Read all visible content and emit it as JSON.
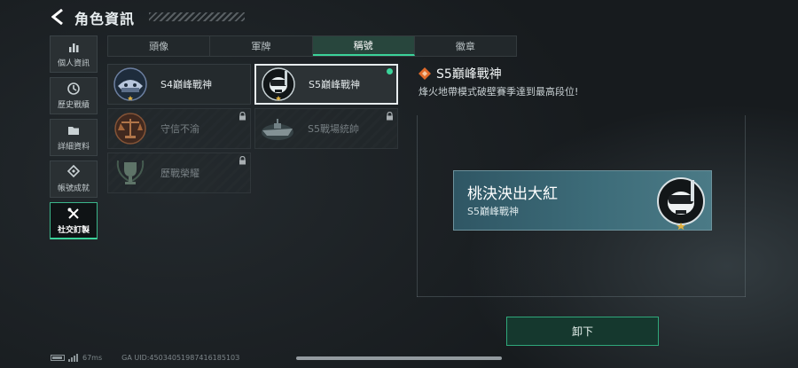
{
  "header": {
    "title": "角色資訊"
  },
  "sidebar": {
    "items": [
      {
        "label": "個人資訊",
        "icon": "bar-chart-icon",
        "active": false
      },
      {
        "label": "歷史戰績",
        "icon": "history-icon",
        "active": false
      },
      {
        "label": "詳細資料",
        "icon": "folder-icon",
        "active": false
      },
      {
        "label": "帳號成就",
        "icon": "achievement-icon",
        "active": false
      },
      {
        "label": "社交訂製",
        "icon": "tools-icon",
        "active": true
      }
    ]
  },
  "tabs": [
    {
      "label": "頭像",
      "active": false
    },
    {
      "label": "軍牌",
      "active": false
    },
    {
      "label": "稱號",
      "active": true
    },
    {
      "label": "徽章",
      "active": false
    }
  ],
  "titles": [
    {
      "name": "S4巔峰戰神",
      "emblem": "armored-skull-emblem",
      "locked": false,
      "selected": false,
      "equipped": false
    },
    {
      "name": "S5巔峰戰神",
      "emblem": "diver-skull-emblem",
      "locked": false,
      "selected": true,
      "equipped": true
    },
    {
      "name": "守信不渝",
      "emblem": "scales-emblem",
      "locked": true,
      "selected": false,
      "equipped": false
    },
    {
      "name": "S5戰場統帥",
      "emblem": "warship-emblem",
      "locked": true,
      "selected": false,
      "equipped": false
    },
    {
      "name": "歷戰榮耀",
      "emblem": "trophy-emblem",
      "locked": true,
      "selected": false,
      "equipped": false
    }
  ],
  "detail": {
    "title": "S5巔峰戰神",
    "description": "烽火地帶模式破壁賽季達到最高段位!"
  },
  "preview": {
    "player_name": "桃決泱出大紅",
    "title": "S5巔峰戰神"
  },
  "unequip_label": "卸下",
  "footer": {
    "ping": "67ms",
    "uid": "GA UID:4503405198741618510З"
  },
  "colors": {
    "accent": "#3bd39a",
    "preview_bg": "#3d6c79",
    "background": "#1a1f22"
  }
}
